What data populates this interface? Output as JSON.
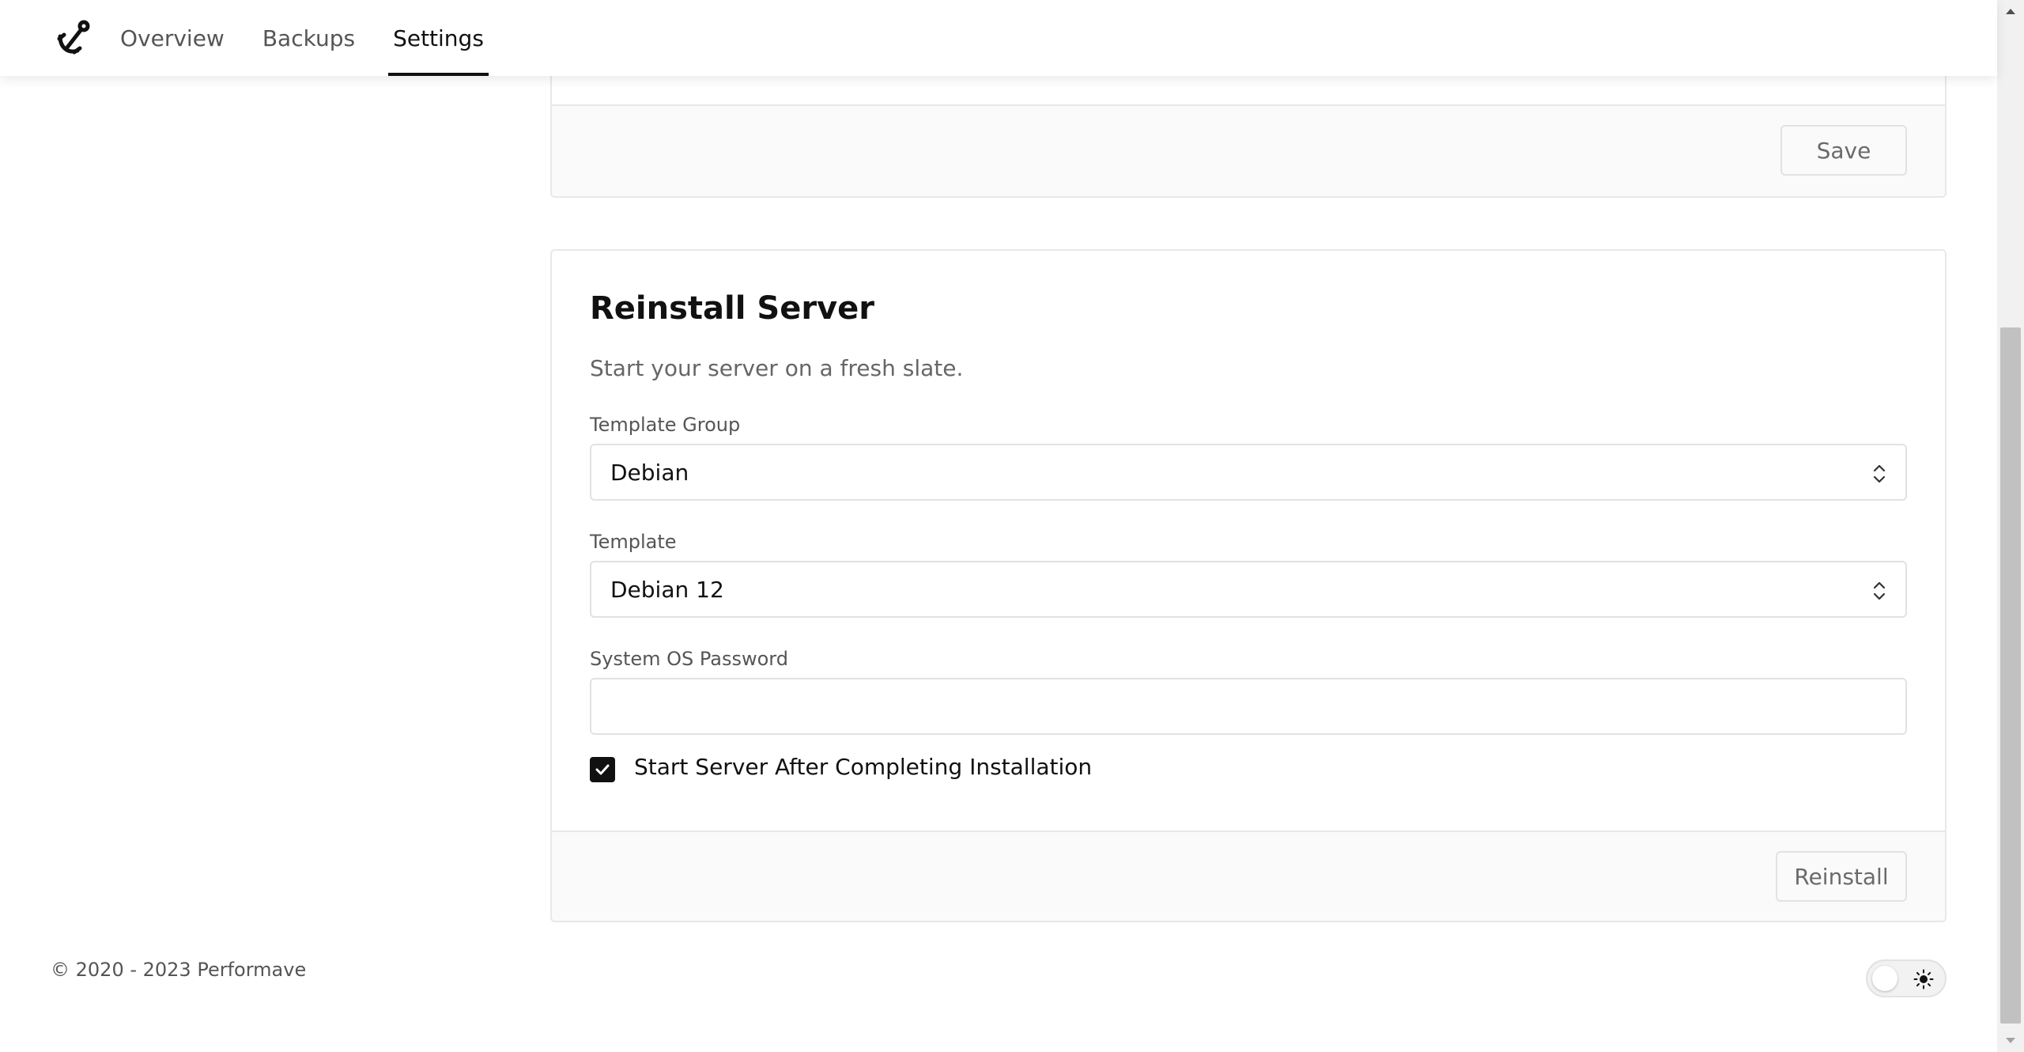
{
  "nav": {
    "logo_icon": "anchor-logo-icon",
    "items": [
      {
        "label": "Overview",
        "active": false
      },
      {
        "label": "Backups",
        "active": false
      },
      {
        "label": "Settings",
        "active": true
      }
    ]
  },
  "top_card": {
    "save_label": "Save"
  },
  "reinstall": {
    "title": "Reinstall Server",
    "subtitle": "Start your server on a fresh slate.",
    "template_group": {
      "label": "Template Group",
      "value": "Debian"
    },
    "template": {
      "label": "Template",
      "value": "Debian 12"
    },
    "password": {
      "label": "System OS Password",
      "value": "",
      "placeholder": ""
    },
    "start_after": {
      "label": "Start Server After Completing Installation",
      "checked": true
    },
    "reinstall_label": "Reinstall"
  },
  "footer": {
    "copyright": "© 2020 - 2023 Performave",
    "theme_icon": "sun-icon"
  },
  "colors": {
    "accent": "#111111",
    "muted_text": "#666666",
    "border": "#e8e8e8",
    "footer_bg": "#fafafa"
  }
}
